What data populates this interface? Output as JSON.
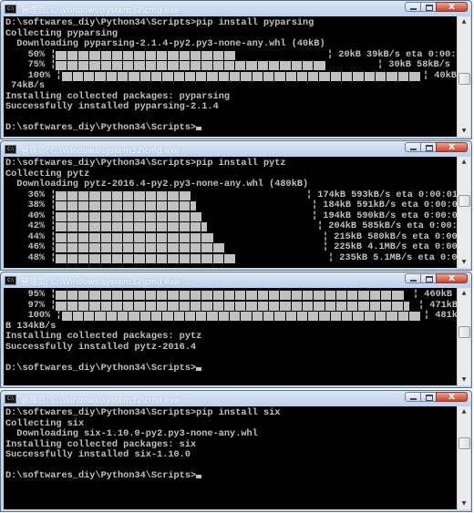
{
  "window_title": "管理员: C:\\Windows\\system32\\cmd.exe",
  "windows": [
    {
      "lines": [
        {
          "text": "D:\\softwares_diy\\Python34\\Scripts>pip install pyparsing"
        },
        {
          "text": "Collecting pyparsing"
        },
        {
          "text": "  Downloading pyparsing-2.1.4-py2.py3-none-any.whl (40kB)"
        },
        {
          "progress": {
            "pct": "    50% ¦",
            "filled_blocks": 16,
            "tail": "¦ 20kB 39kB/s eta 0:00:"
          }
        },
        {
          "progress": {
            "pct": "    75% ¦",
            "filled_blocks": 24,
            "tail": "¦ 30kB 58kB/s"
          }
        },
        {
          "progress": {
            "pct": "    100% ¦",
            "filled_blocks": 32,
            "tail": "¦ 40kB"
          }
        },
        {
          "text": " 74kB/s"
        },
        {
          "text": "Installing collected packages: pyparsing"
        },
        {
          "text": "Successfully installed pyparsing-2.1.4"
        },
        {
          "text": ""
        },
        {
          "text": "D:\\softwares_diy\\Python34\\Scripts>",
          "cursor": true
        }
      ]
    },
    {
      "lines": [
        {
          "text": "D:\\softwares_diy\\Python34\\Scripts>pip install pytz"
        },
        {
          "text": "Collecting pytz"
        },
        {
          "text": "  Downloading pytz-2016.4-py2.py3-none-any.whl (480kB)"
        },
        {
          "progress": {
            "pct": "    36% ¦",
            "filled_blocks": 12,
            "tail": "¦ 174kB 593kB/s eta 0:00:01"
          }
        },
        {
          "progress": {
            "pct": "    38% ¦",
            "filled_blocks": 12.5,
            "tail": "¦ 184kB 591kB/s eta 0:00:0"
          }
        },
        {
          "progress": {
            "pct": "    40% ¦",
            "filled_blocks": 13,
            "tail": "¦ 194kB 590kB/s eta 0:00:0"
          }
        },
        {
          "progress": {
            "pct": "    42% ¦",
            "filled_blocks": 13.5,
            "tail": "¦ 204kB 585kB/s eta 0:00:"
          }
        },
        {
          "progress": {
            "pct": "    44% ¦",
            "filled_blocks": 14,
            "tail": "¦ 215kB 580kB/s eta 0:00"
          }
        },
        {
          "progress": {
            "pct": "    46% ¦",
            "filled_blocks": 15,
            "tail": "¦ 225kB 4.1MB/s eta 0:00"
          }
        },
        {
          "progress": {
            "pct": "    48% ¦",
            "filled_blocks": 16,
            "tail": "¦ 235kB 5.1MB/s eta 0:0"
          }
        }
      ]
    },
    {
      "lines": [
        {
          "progress": {
            "pct": "    95% ¦",
            "filled_blocks": 31,
            "tail": "¦ 460kB"
          }
        },
        {
          "progress": {
            "pct": "    97% ¦",
            "filled_blocks": 31.5,
            "tail": "¦ 471kB"
          }
        },
        {
          "progress": {
            "pct": "    100% ¦",
            "filled_blocks": 32,
            "tail": "¦ 481k"
          }
        },
        {
          "text": "B 134kB/s"
        },
        {
          "text": "Installing collected packages: pytz"
        },
        {
          "text": "Successfully installed pytz-2016.4"
        },
        {
          "text": ""
        },
        {
          "text": "D:\\softwares_diy\\Python34\\Scripts>",
          "cursor": true
        }
      ]
    },
    {
      "lines": [
        {
          "text": "D:\\softwares_diy\\Python34\\Scripts>pip install six"
        },
        {
          "text": "Collecting six"
        },
        {
          "text": "  Downloading six-1.10.0-py2.py3-none-any.whl"
        },
        {
          "text": "Installing collected packages: six"
        },
        {
          "text": "Successfully installed six-1.10.0"
        },
        {
          "text": ""
        },
        {
          "text": "D:\\softwares_diy\\Python34\\Scripts>",
          "cursor": true
        }
      ]
    }
  ],
  "colors": {
    "console_bg": "#000000",
    "console_text": "#c0c0c0",
    "close_button": "#c8442c"
  }
}
